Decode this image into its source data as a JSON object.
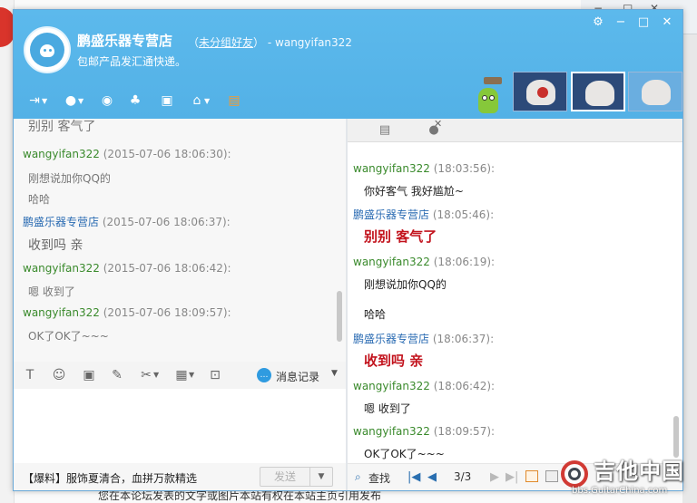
{
  "window": {
    "shop_name": "鹏盛乐器专营店",
    "group_open": "（",
    "group_link": "未分组好友",
    "group_close": "）",
    "contact_id": "- wangyifan322",
    "signature": "包邮产品发汇通快递。",
    "controls": {
      "settings": "⚙",
      "minimize": "−",
      "maximize": "□",
      "close": "✕"
    }
  },
  "background": {
    "footer_text": "您在本论坛发表的文字或图片本站有权在本站主页引用发布"
  },
  "toolbar": {
    "icons": [
      "file-transfer-icon",
      "microphone-icon",
      "video-icon",
      "group-chat-icon",
      "screen-share-icon",
      "remote-assist-icon",
      "app-icon"
    ]
  },
  "history": {
    "top_cut_text": "别别 客气了",
    "messages": [
      {
        "sender": "wangyifan322",
        "time": "(2015-07-06 18:06:30):",
        "lines": [
          "刚想说加你QQ的",
          "哈哈"
        ],
        "sender_color": "green"
      },
      {
        "sender": "鹏盛乐器专营店",
        "time": "(2015-07-06 18:06:37):",
        "lines": [
          "收到吗 亲"
        ],
        "sender_color": "blue"
      },
      {
        "sender": "wangyifan322",
        "time": "(2015-07-06 18:06:42):",
        "lines": [
          "嗯 收到了"
        ],
        "sender_color": "green"
      },
      {
        "sender": "wangyifan322",
        "time": "(2015-07-06 18:09:57):",
        "lines": [
          "OK了OK了~~~"
        ],
        "sender_color": "green"
      }
    ]
  },
  "input_toolbar": {
    "message_record_label": "消息记录"
  },
  "ad_bar": {
    "text": "【爆料】服饰夏清合，血拼万款精选",
    "send_label": "发送",
    "send_dropdown": "▼"
  },
  "record": {
    "messages": [
      {
        "sender": "wangyifan322",
        "time": "(18:03:56):",
        "lines": [
          "你好客气 我好尴尬~"
        ],
        "style": "normal",
        "sender_color": "green"
      },
      {
        "sender": "鹏盛乐器专营店",
        "time": "(18:05:46):",
        "lines": [
          "别别 客气了"
        ],
        "style": "red",
        "sender_color": "blue"
      },
      {
        "sender": "wangyifan322",
        "time": "(18:06:19):",
        "lines": [
          "刚想说加你QQ的",
          "哈哈"
        ],
        "style": "normal",
        "sender_color": "green"
      },
      {
        "sender": "鹏盛乐器专营店",
        "time": "(18:06:37):",
        "lines": [
          "收到吗 亲"
        ],
        "style": "red",
        "sender_color": "blue"
      },
      {
        "sender": "wangyifan322",
        "time": "(18:06:42):",
        "lines": [
          "嗯 收到了"
        ],
        "style": "normal",
        "sender_color": "green"
      },
      {
        "sender": "wangyifan322",
        "time": "(18:09:57):",
        "lines": [
          "OK了OK了~~~"
        ],
        "style": "normal",
        "sender_color": "green"
      }
    ]
  },
  "pager": {
    "search_label": "查找",
    "first": "|◀",
    "prev": "◀",
    "page": "3/3",
    "next": "▶",
    "last": "▶|"
  },
  "watermark": {
    "title": "吉他中国",
    "sub": "bbs.GuitarChina.com"
  },
  "colors": {
    "titlebar": "#56b3e8",
    "sender_green": "#3a8a2c",
    "sender_blue": "#2b6cb3",
    "red_text": "#c2121c"
  }
}
